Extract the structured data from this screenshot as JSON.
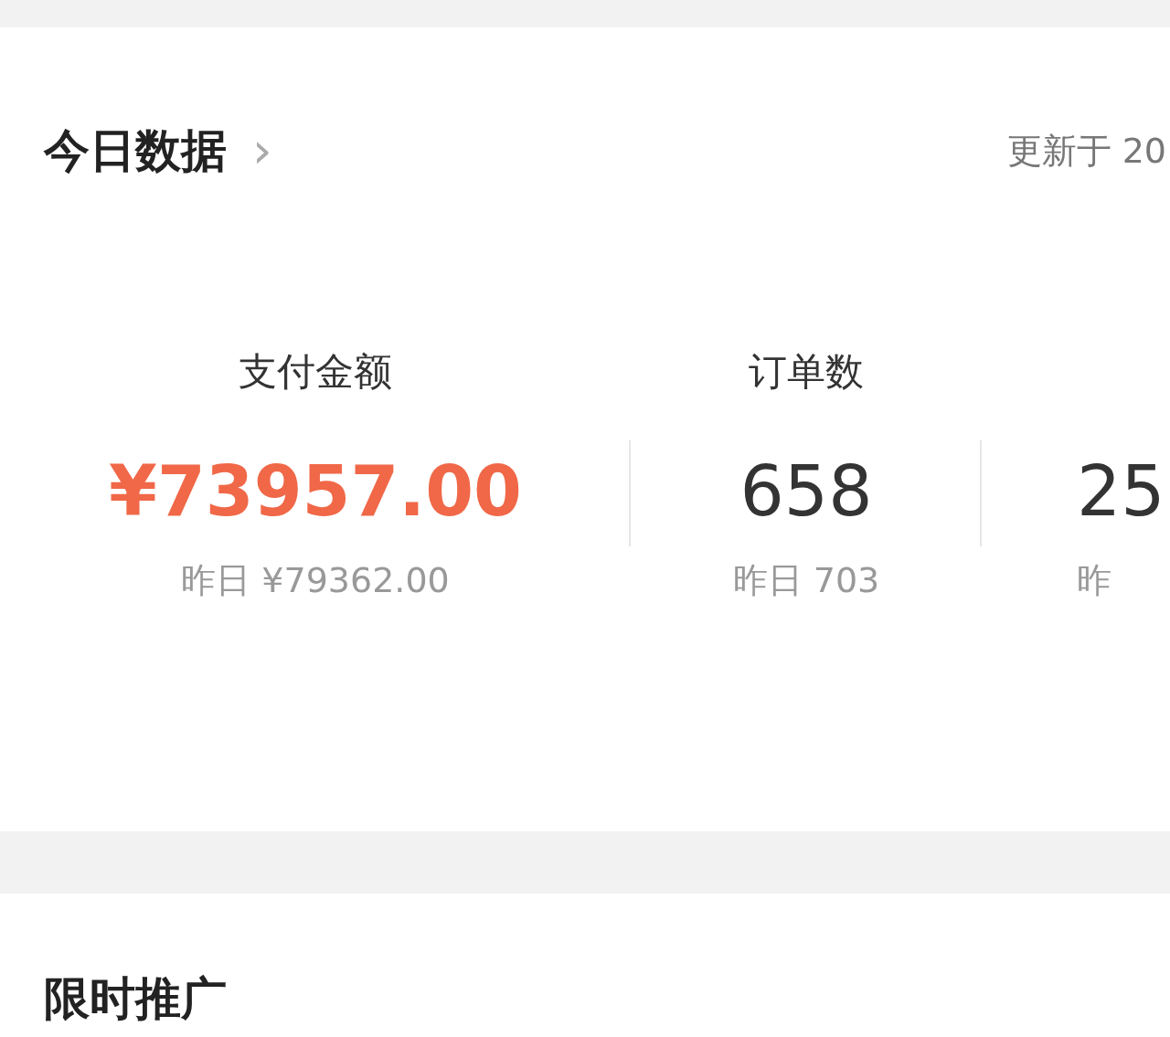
{
  "today_card": {
    "title": "今日数据",
    "chevron": "›",
    "updated": "更新于 20",
    "metrics": [
      {
        "label": "支付金额",
        "value": "¥73957.00",
        "yesterday": "昨日 ¥79362.00",
        "highlight": true
      },
      {
        "label": "订单数",
        "value": "658",
        "yesterday": "昨日 703",
        "highlight": false
      },
      {
        "value": "25",
        "yesterday": "昨",
        "highlight": false
      }
    ]
  },
  "promo_card": {
    "title": "限时推广"
  }
}
